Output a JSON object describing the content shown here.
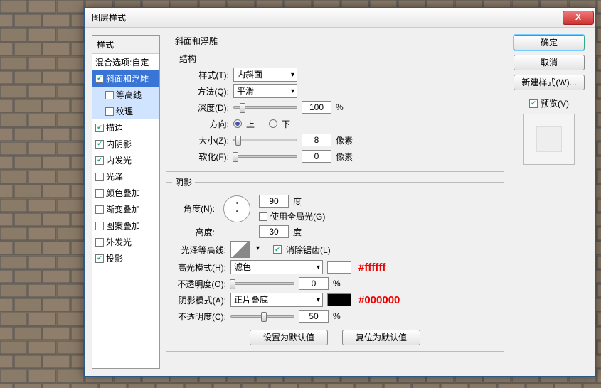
{
  "window": {
    "title": "图层样式"
  },
  "sidebar": {
    "header": "样式",
    "items": [
      {
        "label": "混合选项:自定",
        "checked": null
      },
      {
        "label": "斜面和浮雕",
        "checked": true,
        "selected": true
      },
      {
        "label": "等高线",
        "checked": false,
        "sub": true
      },
      {
        "label": "纹理",
        "checked": false,
        "sub": true
      },
      {
        "label": "描边",
        "checked": true
      },
      {
        "label": "内阴影",
        "checked": true
      },
      {
        "label": "内发光",
        "checked": true
      },
      {
        "label": "光泽",
        "checked": false
      },
      {
        "label": "颜色叠加",
        "checked": false
      },
      {
        "label": "渐变叠加",
        "checked": false
      },
      {
        "label": "图案叠加",
        "checked": false
      },
      {
        "label": "外发光",
        "checked": false
      },
      {
        "label": "投影",
        "checked": true
      }
    ]
  },
  "group1": {
    "legend": "斜面和浮雕",
    "sub_structure": "结构",
    "style_lbl": "样式(T):",
    "style_val": "内斜面",
    "method_lbl": "方法(Q):",
    "method_val": "平滑",
    "depth_lbl": "深度(D):",
    "depth_val": "100",
    "depth_unit": "%",
    "dir_lbl": "方向:",
    "dir_up": "上",
    "dir_down": "下",
    "size_lbl": "大小(Z):",
    "size_val": "8",
    "size_unit": "像素",
    "soften_lbl": "软化(F):",
    "soften_val": "0",
    "soften_unit": "像素"
  },
  "group2": {
    "legend": "阴影",
    "angle_lbl": "角度(N):",
    "angle_val": "90",
    "angle_unit": "度",
    "global_lbl": "使用全局光(G)",
    "global_checked": false,
    "alt_lbl": "高度:",
    "alt_val": "30",
    "alt_unit": "度",
    "contour_lbl": "光泽等高线:",
    "antialias_lbl": "消除锯齿(L)",
    "antialias_checked": true,
    "hl_mode_lbl": "高光模式(H):",
    "hl_mode_val": "滤色",
    "hl_color": "#ffffff",
    "hl_anno": "#ffffff",
    "hl_op_lbl": "不透明度(O):",
    "hl_op_val": "0",
    "hl_op_unit": "%",
    "sh_mode_lbl": "阴影模式(A):",
    "sh_mode_val": "正片叠底",
    "sh_color": "#000000",
    "sh_anno": "#000000",
    "sh_op_lbl": "不透明度(C):",
    "sh_op_val": "50",
    "sh_op_unit": "%",
    "btn_default": "设置为默认值",
    "btn_reset": "复位为默认值"
  },
  "right": {
    "ok": "确定",
    "cancel": "取消",
    "new_style": "新建样式(W)...",
    "preview_lbl": "预览(V)",
    "preview_checked": true
  }
}
